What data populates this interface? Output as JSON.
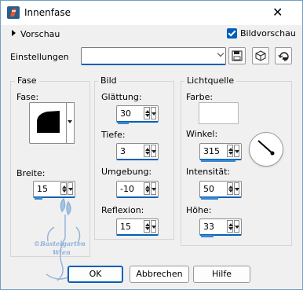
{
  "window": {
    "title": "Innenfase",
    "close_glyph": "✕",
    "app_icon": "psp-brush-icon"
  },
  "preview": {
    "label": "Vorschau",
    "checkbox_label": "Bildvorschau",
    "checked": true
  },
  "settings": {
    "label": "Einstellungen",
    "value": "",
    "buttons": [
      "save-preset-icon",
      "cube-icon",
      "reset-icon"
    ]
  },
  "fase_group": {
    "title": "Fase",
    "fase_label": "Fase:",
    "breite_label": "Breite:",
    "breite_value": "15"
  },
  "bild_group": {
    "title": "Bild",
    "glaettung_label": "Glättung:",
    "glaettung_value": "30",
    "tiefe_label": "Tiefe:",
    "tiefe_value": "3",
    "umgebung_label": "Umgebung:",
    "umgebung_value": "-10",
    "reflexion_label": "Reflexion:",
    "reflexion_value": "15"
  },
  "licht_group": {
    "title": "Lichtquelle",
    "farbe_label": "Farbe:",
    "farbe_color": "#ffffff",
    "winkel_label": "Winkel:",
    "winkel_value": "315",
    "intensitaet_label": "Intensität:",
    "intensitaet_value": "50",
    "hoehe_label": "Höhe:",
    "hoehe_value": "33"
  },
  "watermark": {
    "line1": "©Bastelgarten",
    "line2": "Wien"
  },
  "buttons": {
    "ok": "OK",
    "cancel": "Abbrechen",
    "help": "Hilfe"
  },
  "colors": {
    "accent": "#005fb8",
    "slider": "#3b86cc",
    "watermark": "#8fb1d8"
  }
}
